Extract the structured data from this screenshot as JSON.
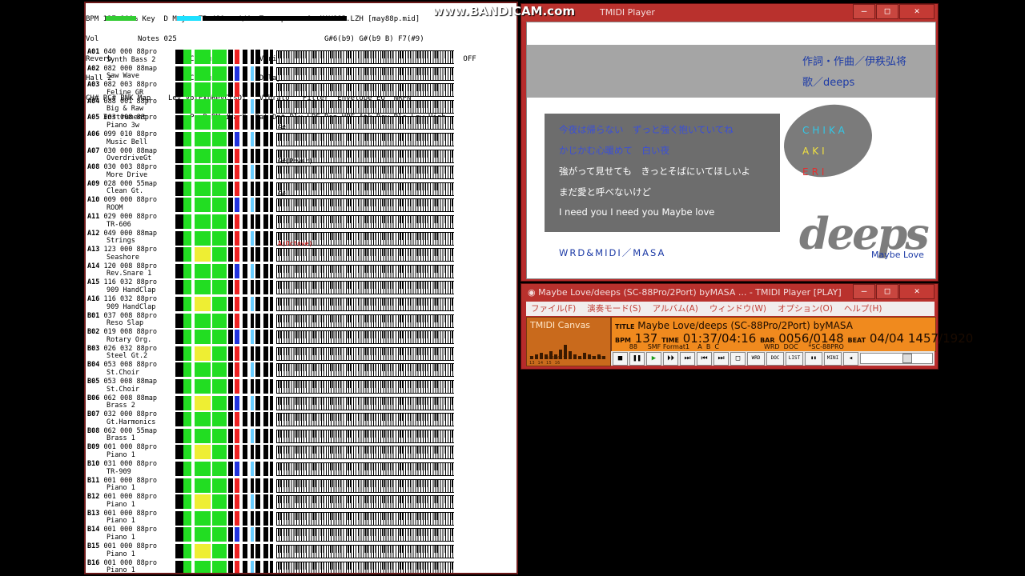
{
  "watermark": "www.BANDICAM.com",
  "status": {
    "header_lines": [
      "BPM 137 100% Key  D Major TB 480   4/4  Transpose  0  MAY88P.LZH [may88p.mid]",
      "Vol         Notes 025                                  G#6(b9) G#(b9 B) F7(#9)",
      "Reverb                  Chorus          Variation    SYS  Insertion1  OFF  Insertion2  OFF",
      "Hall 2                  Chorus 3        Delay 1           Distortion",
      "CH# PC# BNK Map    Lev VolExpRevCrsDT   Vibrato   Filter  Envelope EQ  NRPN",
      "    Instrument          PanP.BModVarF  Rat Dpt Dly LPF Rsn HPF Atk Dcy Rls Low High"
    ],
    "channels": [
      {
        "ch": "A01",
        "pc": "040",
        "bnk": "000",
        "map": "88pro",
        "inst": "Synth Bass 2"
      },
      {
        "ch": "A02",
        "pc": "082",
        "bnk": "000",
        "map": "88map",
        "inst": "Saw Wave"
      },
      {
        "ch": "A03",
        "pc": "082",
        "bnk": "003",
        "map": "88pro",
        "inst": "Feline GR"
      },
      {
        "ch": "A04",
        "pc": "088",
        "bnk": "001",
        "map": "88pro",
        "inst": "Big & Raw"
      },
      {
        "ch": "A05",
        "pc": "003",
        "bnk": "008",
        "map": "88pro",
        "inst": "Piano 3w",
        "chord": "G#"
      },
      {
        "ch": "A06",
        "pc": "099",
        "bnk": "010",
        "map": "88pro",
        "inst": "Music Bell"
      },
      {
        "ch": "A07",
        "pc": "030",
        "bnk": "000",
        "map": "88map",
        "inst": "OverdriveGt",
        "chord": "G#(Power)"
      },
      {
        "ch": "A08",
        "pc": "030",
        "bnk": "003",
        "map": "88pro",
        "inst": "More Drive"
      },
      {
        "ch": "A09",
        "pc": "028",
        "bnk": "000",
        "map": "55map",
        "inst": "Clean Gt.",
        "chord": "G#"
      },
      {
        "ch": "A10",
        "pc": "009",
        "bnk": "000",
        "map": "88pro",
        "inst": "ROOM"
      },
      {
        "ch": "A11",
        "pc": "029",
        "bnk": "000",
        "map": "88pro",
        "inst": "TR-606"
      },
      {
        "ch": "A12",
        "pc": "049",
        "bnk": "000",
        "map": "88map",
        "inst": "Strings",
        "chord": "A(Octove)",
        "chord_red": true
      },
      {
        "ch": "A13",
        "pc": "123",
        "bnk": "000",
        "map": "88pro",
        "inst": "Seashore"
      },
      {
        "ch": "A14",
        "pc": "120",
        "bnk": "008",
        "map": "88pro",
        "inst": "Rev.Snare 1"
      },
      {
        "ch": "A15",
        "pc": "116",
        "bnk": "032",
        "map": "88pro",
        "inst": "909 HandClap"
      },
      {
        "ch": "A16",
        "pc": "116",
        "bnk": "032",
        "map": "88pro",
        "inst": "909 HandClap"
      },
      {
        "ch": "B01",
        "pc": "037",
        "bnk": "008",
        "map": "88pro",
        "inst": "Reso Slap"
      },
      {
        "ch": "B02",
        "pc": "019",
        "bnk": "008",
        "map": "88pro",
        "inst": "Rotary Org."
      },
      {
        "ch": "B03",
        "pc": "026",
        "bnk": "032",
        "map": "88pro",
        "inst": "Steel Gt.2"
      },
      {
        "ch": "B04",
        "pc": "053",
        "bnk": "008",
        "map": "88pro",
        "inst": "St.Choir"
      },
      {
        "ch": "B05",
        "pc": "053",
        "bnk": "008",
        "map": "88map",
        "inst": "St.Choir"
      },
      {
        "ch": "B06",
        "pc": "062",
        "bnk": "008",
        "map": "88map",
        "inst": "Brass 2"
      },
      {
        "ch": "B07",
        "pc": "032",
        "bnk": "000",
        "map": "88pro",
        "inst": "Gt.Harmonics"
      },
      {
        "ch": "B08",
        "pc": "062",
        "bnk": "000",
        "map": "55map",
        "inst": "Brass 1"
      },
      {
        "ch": "B09",
        "pc": "001",
        "bnk": "000",
        "map": "88pro",
        "inst": "Piano 1"
      },
      {
        "ch": "B10",
        "pc": "031",
        "bnk": "000",
        "map": "88pro",
        "inst": "TR-909"
      },
      {
        "ch": "B11",
        "pc": "001",
        "bnk": "000",
        "map": "88pro",
        "inst": "Piano 1"
      },
      {
        "ch": "B12",
        "pc": "001",
        "bnk": "000",
        "map": "88pro",
        "inst": "Piano 1"
      },
      {
        "ch": "B13",
        "pc": "001",
        "bnk": "000",
        "map": "88pro",
        "inst": "Piano 1"
      },
      {
        "ch": "B14",
        "pc": "001",
        "bnk": "000",
        "map": "88pro",
        "inst": "Piano 1"
      },
      {
        "ch": "B15",
        "pc": "001",
        "bnk": "000",
        "map": "88pro",
        "inst": "Piano 1"
      },
      {
        "ch": "B16",
        "pc": "001",
        "bnk": "000",
        "map": "88pro",
        "inst": "Piano 1"
      }
    ]
  },
  "wrd_window": {
    "title": "TMIDI Player",
    "credit1": "作詞・作曲／伊秩弘将",
    "credit2": "歌／deeps",
    "lyrics": [
      {
        "text": "今夜は帰らない　ずっと強く抱いていてね",
        "color": "#3a4fd8"
      },
      {
        "text": "かじかむ心暖めて　白い夜",
        "color": "#3a4fd8"
      },
      {
        "text": "強がって見せても　きっとそばにいてほしいよ",
        "color": "#ffffff"
      },
      {
        "text": "まだ愛と呼べないけど",
        "color": "#ffffff"
      },
      {
        "text": "I need you I need you Maybe love",
        "color": "#ffffff"
      }
    ],
    "singers": [
      {
        "name": "CHIKA",
        "color": "#31c8e8"
      },
      {
        "name": "AKI",
        "color": "#f0e040"
      },
      {
        "name": "ERI",
        "color": "#e23030"
      }
    ],
    "logo": "deeps",
    "logo_sub": "Maybe Love",
    "footer": "WRD&MIDI／MASA"
  },
  "player": {
    "title": "Maybe Love/deeps (SC-88Pro/2Port) byMASA       ... - TMIDI Player [PLAY]",
    "menu": [
      "ファイル(F)",
      "演奏モード(S)",
      "アルバム(A)",
      "ウィンドウ(W)",
      "オプション(O)",
      "ヘルプ(H)"
    ],
    "canvas_title": "TMIDI Canvas",
    "canvas_nums": "1 2 3 4 5 6 7 8 9 10 11 12 13 14 15 16",
    "song_title": "Maybe Love/deeps (SC-88Pro/2Port) byMASA",
    "bpm": "137",
    "time": "01:37/04:16",
    "bar": "0056/0148",
    "beat": "04/04",
    "tick": "1457/1920",
    "row3": "       88     SMF Format1    A  B  C                      WRD  DOC     *SC-88PRO",
    "labels": {
      "title": "TITLE",
      "bpm": "BPM",
      "time": "TIME",
      "bar": "BAR",
      "beat": "BEAT"
    },
    "buttons": [
      "■",
      "❚❚",
      "▶",
      "⏵⏵",
      "⏭",
      "⏮",
      "⏭",
      "□",
      "WRD",
      "DOC",
      "LIST",
      "▮▮",
      "MINI",
      "◂"
    ]
  }
}
